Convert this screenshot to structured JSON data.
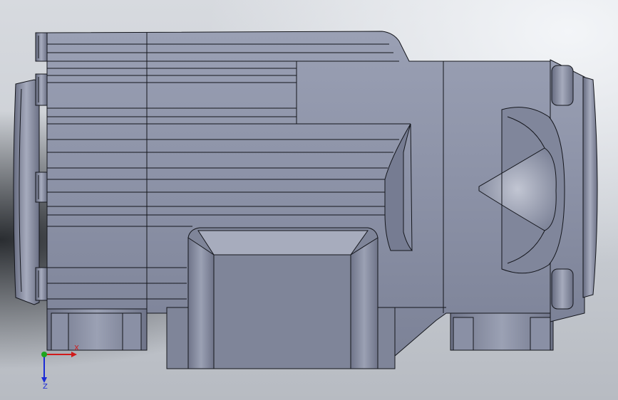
{
  "window": {
    "background_top": "#d7dadf",
    "background_bottom": "#b7bbc2"
  },
  "model": {
    "body_color": "#8d93a8",
    "shadow_color": "#6c7186",
    "highlight_color": "#b4b9c8",
    "edge_color": "#14161c"
  },
  "triad": {
    "x_label": "X",
    "z_label": "Z",
    "x_color": "#d11a1a",
    "y_color": "#1ea51e",
    "z_color": "#1a2ad6"
  }
}
